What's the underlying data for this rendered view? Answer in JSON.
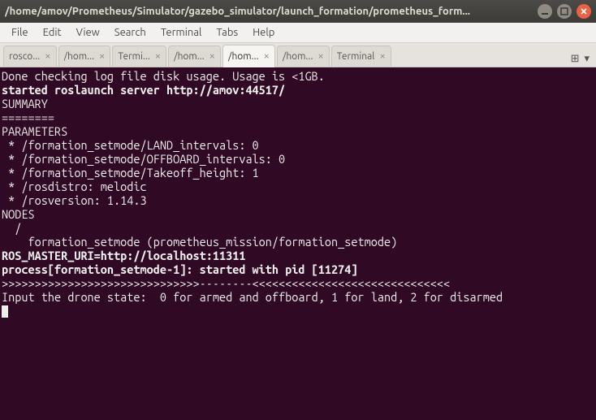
{
  "titlebar": {
    "title": "/home/amov/Prometheus/Simulator/gazebo_simulator/launch_formation/prometheus_form..."
  },
  "menubar": {
    "items": [
      "File",
      "Edit",
      "View",
      "Search",
      "Terminal",
      "Tabs",
      "Help"
    ]
  },
  "tabs": {
    "items": [
      {
        "label": "rosco...",
        "active": false
      },
      {
        "label": "/hom...",
        "active": false
      },
      {
        "label": "Termi...",
        "active": false
      },
      {
        "label": "/hom...",
        "active": false
      },
      {
        "label": "/hom...",
        "active": true
      },
      {
        "label": "/hom...",
        "active": false
      },
      {
        "label": "Terminal",
        "active": false
      }
    ],
    "close_glyph": "×",
    "newtab_glyph": "⊞",
    "menu_glyph": "▾"
  },
  "terminal": {
    "lines": [
      {
        "text": "Done checking log file disk usage. Usage is <1GB.",
        "bold": false
      },
      {
        "text": "",
        "bold": false
      },
      {
        "text": "started roslaunch server http://amov:44517/",
        "bold": true
      },
      {
        "text": "",
        "bold": false
      },
      {
        "text": "SUMMARY",
        "bold": false
      },
      {
        "text": "========",
        "bold": false
      },
      {
        "text": "",
        "bold": false
      },
      {
        "text": "PARAMETERS",
        "bold": false
      },
      {
        "text": " * /formation_setmode/LAND_intervals: 0",
        "bold": false
      },
      {
        "text": " * /formation_setmode/OFFBOARD_intervals: 0",
        "bold": false
      },
      {
        "text": " * /formation_setmode/Takeoff_height: 1",
        "bold": false
      },
      {
        "text": " * /rosdistro: melodic",
        "bold": false
      },
      {
        "text": " * /rosversion: 1.14.3",
        "bold": false
      },
      {
        "text": "",
        "bold": false
      },
      {
        "text": "NODES",
        "bold": false
      },
      {
        "text": "  /",
        "bold": false
      },
      {
        "text": "    formation_setmode (prometheus_mission/formation_setmode)",
        "bold": false
      },
      {
        "text": "",
        "bold": false
      },
      {
        "text": "ROS_MASTER_URI=http://localhost:11311",
        "bold": true
      },
      {
        "text": "",
        "bold": false
      },
      {
        "text": "process[formation_setmode-1]: started with pid [11274]",
        "bold": true
      },
      {
        "text": ">>>>>>>>>>>>>>>>>>>>>>>>>>>>>>--------<<<<<<<<<<<<<<<<<<<<<<<<<<<<<<",
        "bold": false
      },
      {
        "text": "Input the drone state:  0 for armed and offboard, 1 for land, 2 for disarmed",
        "bold": false
      }
    ]
  }
}
